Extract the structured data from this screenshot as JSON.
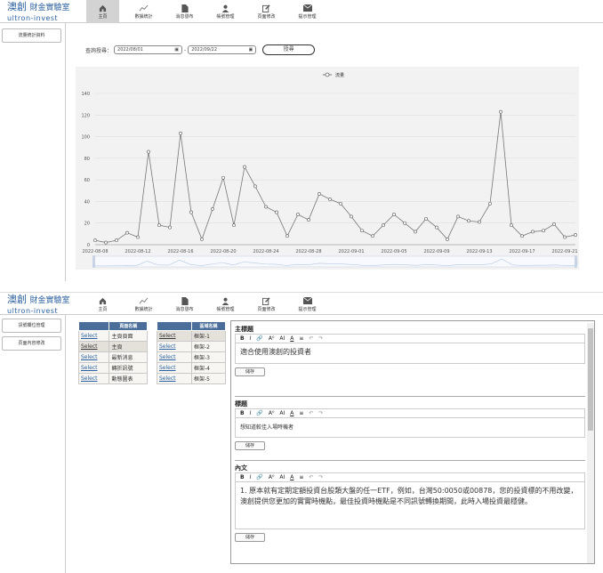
{
  "logo": {
    "main": "澳創",
    "sub": "財金實驗室",
    "en": "ultron-invest"
  },
  "nav": [
    {
      "label": "主頁",
      "icon": "home-icon"
    },
    {
      "label": "數據統計",
      "icon": "chart-icon"
    },
    {
      "label": "消息發布",
      "icon": "document-icon"
    },
    {
      "label": "帳號管理",
      "icon": "user-icon"
    },
    {
      "label": "頁面修改",
      "icon": "edit-icon"
    },
    {
      "label": "提示管理",
      "icon": "mail-icon"
    }
  ],
  "top": {
    "sidebar_button": "流量統計資料",
    "query_label": "查詢授尋：",
    "date_from": "2022/08/01",
    "date_to": "2022/09/22",
    "query_button": "授尋"
  },
  "chart_data": {
    "type": "line",
    "legend": "流量",
    "legend_position": "top-center",
    "ylim": [
      0,
      140
    ],
    "yticks": [
      0,
      20,
      40,
      60,
      80,
      100,
      120,
      140
    ],
    "xtick_labels": [
      "2022-08-08",
      "2022-08-12",
      "2022-08-16",
      "2022-08-20",
      "2022-08-24",
      "2022-08-28",
      "2022-09-01",
      "2022-09-05",
      "2022-09-09",
      "2022-09-13",
      "2022-09-17",
      "2022-09-21"
    ],
    "x": [
      "2022-08-08",
      "2022-08-09",
      "2022-08-10",
      "2022-08-11",
      "2022-08-12",
      "2022-08-13",
      "2022-08-14",
      "2022-08-15",
      "2022-08-16",
      "2022-08-17",
      "2022-08-18",
      "2022-08-19",
      "2022-08-20",
      "2022-08-21",
      "2022-08-22",
      "2022-08-23",
      "2022-08-24",
      "2022-08-25",
      "2022-08-26",
      "2022-08-27",
      "2022-08-28",
      "2022-08-29",
      "2022-08-30",
      "2022-08-31",
      "2022-09-01",
      "2022-09-02",
      "2022-09-03",
      "2022-09-04",
      "2022-09-05",
      "2022-09-06",
      "2022-09-07",
      "2022-09-08",
      "2022-09-09",
      "2022-09-10",
      "2022-09-11",
      "2022-09-12",
      "2022-09-13",
      "2022-09-14",
      "2022-09-15",
      "2022-09-16",
      "2022-09-17",
      "2022-09-18",
      "2022-09-19",
      "2022-09-20",
      "2022-09-21",
      "2022-09-22"
    ],
    "values": [
      4,
      2,
      4,
      11,
      7,
      86,
      18,
      16,
      103,
      30,
      5,
      33,
      62,
      18,
      72,
      54,
      35,
      30,
      8,
      28,
      23,
      47,
      42,
      38,
      26,
      13,
      8,
      18,
      28,
      20,
      12,
      24,
      16,
      5,
      26,
      22,
      21,
      38,
      123,
      18,
      8,
      12,
      13,
      19,
      7,
      9
    ],
    "grid": true
  },
  "bottom": {
    "sidebar_buttons": [
      "訊號欄位管理",
      "頁面內容修改"
    ],
    "table1": {
      "header": "頁面名稱",
      "rows": [
        {
          "action": "Select",
          "name": "主頁頁面"
        },
        {
          "action": "Select",
          "name": "主頁"
        },
        {
          "action": "Select",
          "name": "最新消息"
        },
        {
          "action": "Select",
          "name": "轉折訊號"
        },
        {
          "action": "Select",
          "name": "動態圖表"
        }
      ]
    },
    "table2": {
      "header": "區域名稱",
      "rows": [
        {
          "action": "Select",
          "name": "框架-1"
        },
        {
          "action": "Select",
          "name": "框架-2"
        },
        {
          "action": "Select",
          "name": "框架-3"
        },
        {
          "action": "Select",
          "name": "框架-4"
        },
        {
          "action": "Select",
          "name": "框架-5"
        }
      ]
    },
    "toolbar": {
      "bold": "B",
      "italic": "I",
      "link": "🔗",
      "font_size": "A⁰",
      "ai": "AI",
      "color": "A",
      "align": "≡",
      "undo": "↶",
      "redo": "↷"
    },
    "sections": [
      {
        "title": "主標題",
        "content": "適合使用澳創的投資者",
        "save": "儲存"
      },
      {
        "title": "標題",
        "content": "想知道較佳入場時機者",
        "save": "儲存"
      },
      {
        "title": "內文",
        "content": "1. 原本就有定期定額投資台股類大盤的任一ETF，例如，台灣50:0050或00878，您的投資標的不用改變，澳創提供您更加的實實時機點，最佳投資時機點是不同訊號轉換期間，此時入場投資最穩健。",
        "save": "儲存"
      }
    ]
  }
}
